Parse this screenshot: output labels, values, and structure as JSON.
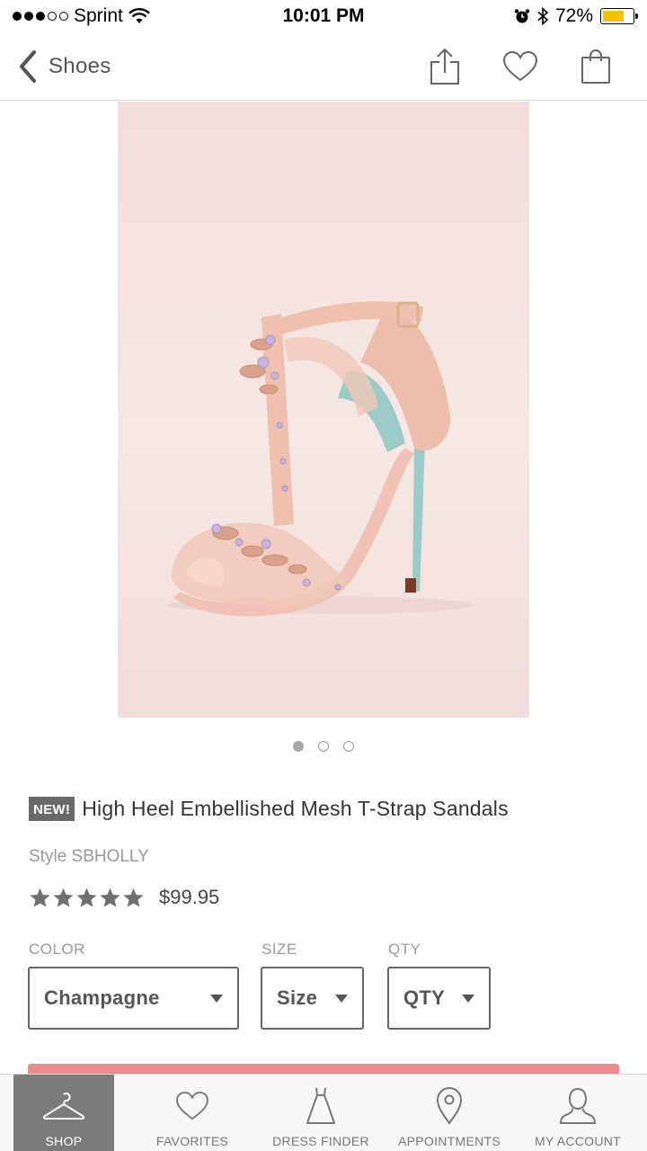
{
  "status_bar": {
    "carrier": "Sprint",
    "time": "10:01 PM",
    "battery": "72%",
    "battery_level": 0.72,
    "battery_color": "#f2c200"
  },
  "nav": {
    "back_label": "Shoes",
    "icons": [
      "share-icon",
      "heart-icon",
      "shopping-bag-icon"
    ]
  },
  "carousel": {
    "count": 3,
    "active_index": 0
  },
  "product": {
    "badge": "NEW!",
    "title": "High Heel Embellished Mesh T-Strap Sandals",
    "style": "Style SBHOLLY",
    "rating": 5,
    "price": "$99.95"
  },
  "selectors": {
    "color": {
      "label": "COLOR",
      "value": "Champagne"
    },
    "size": {
      "label": "SIZE",
      "value": "Size"
    },
    "qty": {
      "label": "QTY",
      "value": "QTY"
    }
  },
  "add_button": {
    "color": "#ea8b8c"
  },
  "tabs": [
    {
      "label": "SHOP",
      "icon": "hanger-icon",
      "active": true
    },
    {
      "label": "FAVORITES",
      "icon": "heart-icon",
      "active": false
    },
    {
      "label": "DRESS FINDER",
      "icon": "dress-icon",
      "active": false
    },
    {
      "label": "APPOINTMENTS",
      "icon": "location-pin-icon",
      "active": false
    },
    {
      "label": "MY ACCOUNT",
      "icon": "person-icon",
      "active": false
    }
  ],
  "colors": {
    "accent": "#ea8b8c",
    "active_tab": "#7b7b7b",
    "badge": "#6a6a6a"
  }
}
